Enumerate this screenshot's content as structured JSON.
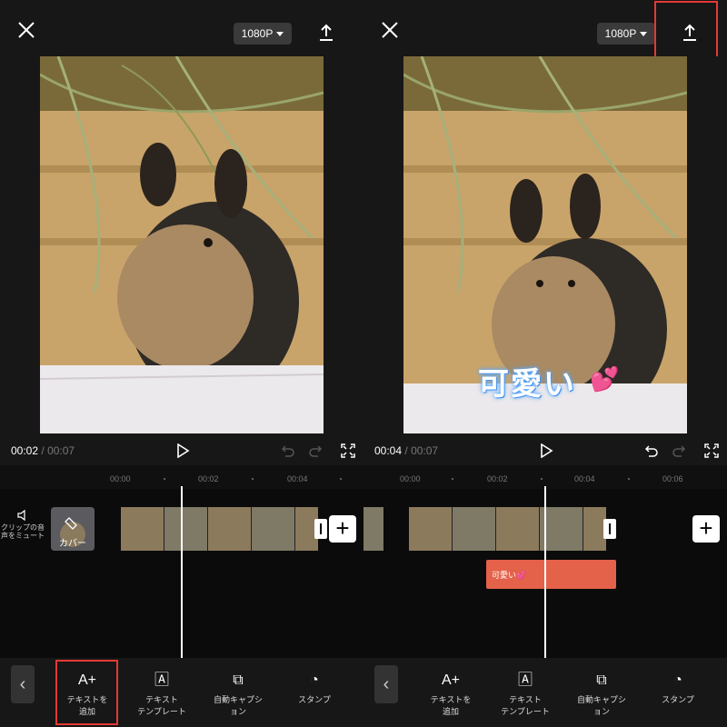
{
  "colors": {
    "background": "#171717",
    "highlight": "#e53935",
    "text_clip": "#e4614a"
  },
  "left": {
    "resolution_label": "1080P",
    "time_current": "00:02",
    "time_separator": "/",
    "time_total": "00:07",
    "ruler": [
      "00:00",
      "00:02",
      "00:04"
    ],
    "mute_label": "クリップの音声をミュート",
    "cover_label": "カバー",
    "tools": [
      {
        "icon": "text-add-icon",
        "label_line1": "テキストを",
        "label_line2": "追加"
      },
      {
        "icon": "text-template-icon",
        "label_line1": "テキスト",
        "label_line2": "テンプレート"
      },
      {
        "icon": "auto-caption-icon",
        "label_line1": "自動キャプシ",
        "label_line2": "ョン"
      },
      {
        "icon": "sticker-icon",
        "label_line1": "スタンプ",
        "label_line2": ""
      }
    ]
  },
  "right": {
    "resolution_label": "1080P",
    "time_current": "00:04",
    "time_separator": "/",
    "time_total": "00:07",
    "ruler": [
      "00:00",
      "00:02",
      "00:04",
      "00:06"
    ],
    "caption_text": "可愛い",
    "text_clip_label": "可愛い💕",
    "tools": [
      {
        "icon": "text-add-icon",
        "label_line1": "テキストを",
        "label_line2": "追加"
      },
      {
        "icon": "text-template-icon",
        "label_line1": "テキスト",
        "label_line2": "テンプレート"
      },
      {
        "icon": "auto-caption-icon",
        "label_line1": "自動キャプシ",
        "label_line2": "ョン"
      },
      {
        "icon": "sticker-icon",
        "label_line1": "スタンプ",
        "label_line2": ""
      }
    ]
  }
}
